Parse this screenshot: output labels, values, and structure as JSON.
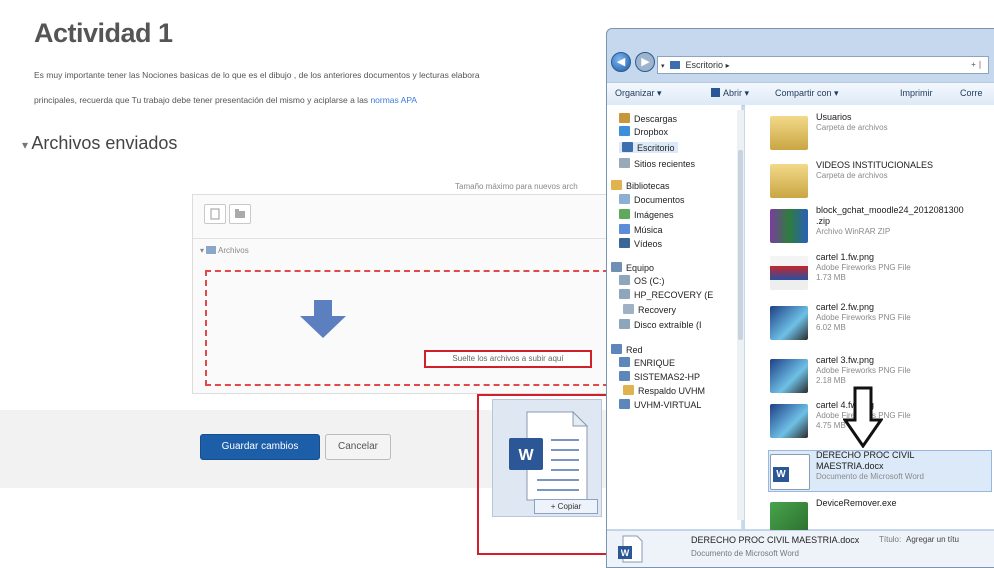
{
  "page": {
    "title": "Actividad 1",
    "desc_line1": "Es muy importante tener las Nociones basicas de lo que es el dibujo , de los anteriores documentos y lecturas elabora",
    "desc_line2": "principales, recuerda que Tu trabajo debe tener presentación del mismo y aciplarse a las",
    "desc_link": "normas APA",
    "section_title": "Archivos enviados",
    "max_size": "Tamaño máximo para nuevos arch",
    "folder_label": "Archivos",
    "drop_text": "Suelte los archivos a subir aquí",
    "save_button": "Guardar cambios",
    "cancel_button": "Cancelar",
    "copy_tooltip": "+ Copiar",
    "drag_icon": "word-document-icon"
  },
  "dialog": {
    "path": "Escritorio",
    "path_arrow": "▸",
    "search_hint": "+ ∣",
    "toolbar": {
      "organize": "Organizar ▾",
      "open": "Abrir ▾",
      "share": "Compartir con ▾",
      "print": "Imprimir",
      "email": "Corre"
    },
    "nav_items": [
      {
        "label": "Descargas",
        "color": "#c7973b"
      },
      {
        "label": "Dropbox",
        "color": "#3c8fd8"
      },
      {
        "label": "Escritorio",
        "color": "#3d6fb0"
      },
      {
        "label": "Sitios recientes",
        "color": "#9aa9b8"
      },
      {
        "label": "Bibliotecas",
        "color": "#e1b34f"
      },
      {
        "label": "Documentos",
        "color": "#8cb0d4"
      },
      {
        "label": "Imágenes",
        "color": "#5ea95a"
      },
      {
        "label": "Música",
        "color": "#5b8ed6"
      },
      {
        "label": "Vídeos",
        "color": "#3a6796"
      },
      {
        "label": "Equipo",
        "color": "#6f8fb3"
      },
      {
        "label": "OS (C:)",
        "color": "#8ea6bc"
      },
      {
        "label": "HP_RECOVERY (E",
        "color": "#8ea6bc"
      },
      {
        "label": "Recovery",
        "color": "#9fb2c4"
      },
      {
        "label": "Disco extraíble (I",
        "color": "#8ea6bc"
      },
      {
        "label": "Red",
        "color": "#5d87bb"
      },
      {
        "label": "ENRIQUE",
        "color": "#5d87bb"
      },
      {
        "label": "SISTEMAS2-HP",
        "color": "#5d87bb"
      },
      {
        "label": "Respaldo UVHM",
        "color": "#e1b34f"
      },
      {
        "label": "UVHM-VIRTUAL",
        "color": "#5d87bb"
      }
    ],
    "files": [
      {
        "name": "Usuarios",
        "type": "Carpeta de archivos",
        "size": "",
        "icon": "folder-icon"
      },
      {
        "name": "VIDEOS INSTITUCIONALES",
        "type": "Carpeta de archivos",
        "size": "",
        "icon": "folder-icon"
      },
      {
        "name": "block_gchat_moodle24_2012081300",
        "name2": ".zip",
        "type": "Archivo WinRAR ZIP",
        "size": "",
        "icon": "winrar-icon"
      },
      {
        "name": "cartel 1.fw.png",
        "type": "Adobe Fireworks PNG File",
        "size": "1.73 MB",
        "icon": "image-icon"
      },
      {
        "name": "cartel 2.fw.png",
        "type": "Adobe Fireworks PNG File",
        "size": "6.02 MB",
        "icon": "image-icon"
      },
      {
        "name": "cartel 3.fw.png",
        "type": "Adobe Fireworks PNG File",
        "size": "2.18 MB",
        "icon": "image-icon"
      },
      {
        "name": "cartel 4.fw.png",
        "type": "Adobe Fireworks PNG File",
        "size": "4.75 MB",
        "icon": "image-icon"
      },
      {
        "name": "DERECHO PROC CIVIL",
        "name2": "MAESTRIA.docx",
        "type": "Documento de Microsoft Word",
        "size": "",
        "icon": "word-document-icon"
      },
      {
        "name": "DeviceRemover.exe",
        "type": "",
        "size": "",
        "icon": "exe-icon"
      }
    ],
    "details": {
      "filename": "DERECHO PROC CIVIL MAESTRIA.docx",
      "type": "Documento de Microsoft Word",
      "title_label": "Título:",
      "title_value": "Agregar un títu"
    }
  },
  "colors": {
    "accent_blue": "#1d5ea9",
    "highlight_red": "#d0202c",
    "dropzone_red": "#e04a4a",
    "word_blue": "#2b5797"
  }
}
